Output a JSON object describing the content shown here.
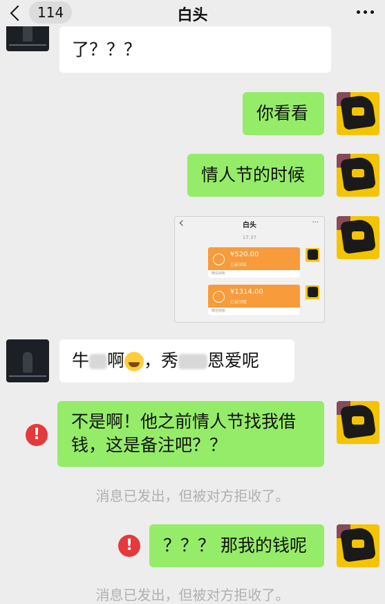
{
  "header": {
    "back_count": "114",
    "title": "白头"
  },
  "messages": {
    "m1_text": "了？？？",
    "m2_text": "你看看",
    "m3_text": "情人节的时候",
    "m5_prefix": "牛",
    "m5_mid": "啊",
    "m5_comma": "，秀",
    "m5_suffix": "恩爱呢",
    "m6_text": "不是啊！他之前情人节找我借钱，这是备注吧？？",
    "m7_text": "？？？ 那我的钱呢"
  },
  "notices": {
    "n1": "消息已发出，但被对方拒收了。",
    "n2": "消息已发出，但被对方拒收了。"
  },
  "embedded_screenshot": {
    "title": "白头",
    "menu": "···",
    "time": "17:37",
    "packets": [
      {
        "amount": "¥520.00",
        "note": "已被领取",
        "footer": "微信转账"
      },
      {
        "amount": "¥1314.00",
        "note": "已被领取",
        "footer": "微信转账"
      }
    ]
  },
  "error_icon": "!",
  "colors": {
    "green_bubble": "#95ec69",
    "error_red": "#e5393b",
    "background": "#ededed",
    "transfer_orange": "#f79b3b"
  }
}
